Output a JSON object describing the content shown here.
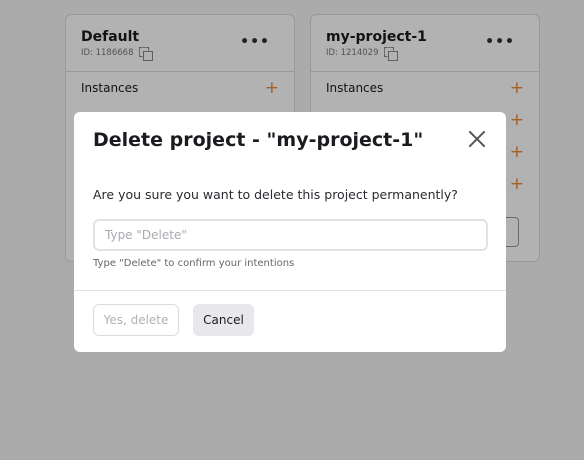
{
  "projects": [
    {
      "name": "Default",
      "id_label": "ID: 1186668",
      "rows": [
        {
          "label": "Instances"
        }
      ]
    },
    {
      "name": "my-project-1",
      "id_label": "ID: 1214029",
      "rows": [
        {
          "label": "Instances"
        }
      ]
    }
  ],
  "card_menu_label": "•••",
  "add_label": "+",
  "modal": {
    "title": "Delete project - \"my-project-1\"",
    "question": "Are you sure you want to delete this project permanently?",
    "input_value": "",
    "input_placeholder": "Type \"Delete\"",
    "hint": "Type \"Delete\" to confirm your intentions",
    "confirm_label": "Yes, delete",
    "cancel_label": "Cancel"
  },
  "colors": {
    "accent": "#e88a3c",
    "overlay": "rgba(0,0,0,0.30)"
  }
}
